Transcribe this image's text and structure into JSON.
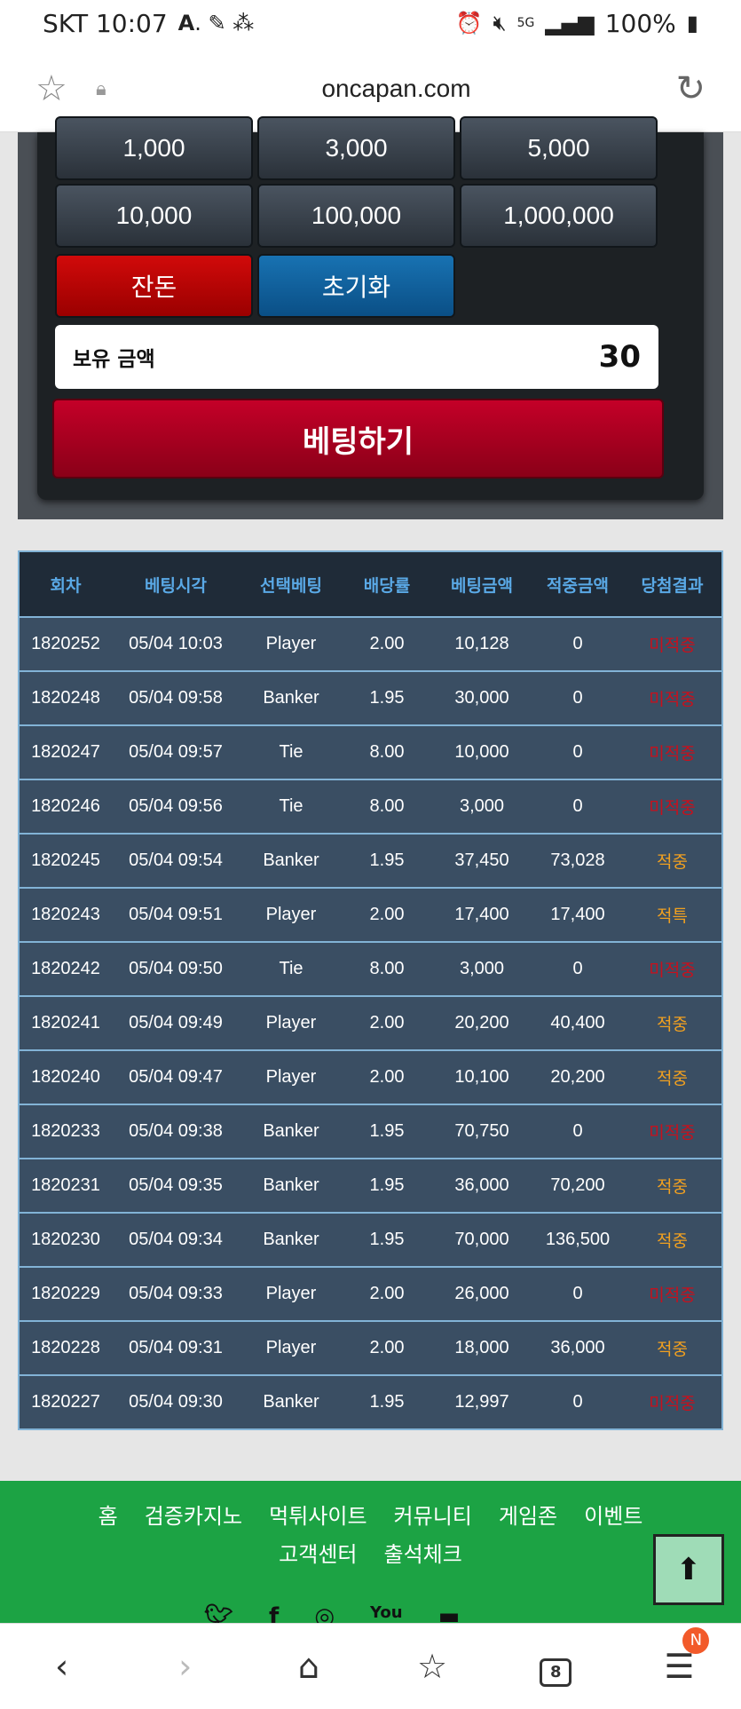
{
  "status_bar": {
    "carrier_time": "SKT 10:07",
    "battery": "100%",
    "network": "5G"
  },
  "browser": {
    "url": "oncapan.com",
    "tabs_count": "8",
    "notification_badge": "N"
  },
  "chips": [
    "1,000",
    "3,000",
    "5,000",
    "10,000",
    "100,000",
    "1,000,000"
  ],
  "actions": {
    "change_label": "잔돈",
    "reset_label": "초기화",
    "bet_label": "베팅하기"
  },
  "balance": {
    "label": "보유 금액",
    "value": "30"
  },
  "table": {
    "headers": [
      "회차",
      "베팅시각",
      "선택베팅",
      "배당률",
      "베팅금액",
      "적중금액",
      "당첨결과"
    ],
    "rows": [
      [
        "1820252",
        "05/04 10:03",
        "Player",
        "2.00",
        "10,128",
        "0",
        "미적중"
      ],
      [
        "1820248",
        "05/04 09:58",
        "Banker",
        "1.95",
        "30,000",
        "0",
        "미적중"
      ],
      [
        "1820247",
        "05/04 09:57",
        "Tie",
        "8.00",
        "10,000",
        "0",
        "미적중"
      ],
      [
        "1820246",
        "05/04 09:56",
        "Tie",
        "8.00",
        "3,000",
        "0",
        "미적중"
      ],
      [
        "1820245",
        "05/04 09:54",
        "Banker",
        "1.95",
        "37,450",
        "73,028",
        "적중"
      ],
      [
        "1820243",
        "05/04 09:51",
        "Player",
        "2.00",
        "17,400",
        "17,400",
        "적특"
      ],
      [
        "1820242",
        "05/04 09:50",
        "Tie",
        "8.00",
        "3,000",
        "0",
        "미적중"
      ],
      [
        "1820241",
        "05/04 09:49",
        "Player",
        "2.00",
        "20,200",
        "40,400",
        "적중"
      ],
      [
        "1820240",
        "05/04 09:47",
        "Player",
        "2.00",
        "10,100",
        "20,200",
        "적중"
      ],
      [
        "1820233",
        "05/04 09:38",
        "Banker",
        "1.95",
        "70,750",
        "0",
        "미적중"
      ],
      [
        "1820231",
        "05/04 09:35",
        "Banker",
        "1.95",
        "36,000",
        "70,200",
        "적중"
      ],
      [
        "1820230",
        "05/04 09:34",
        "Banker",
        "1.95",
        "70,000",
        "136,500",
        "적중"
      ],
      [
        "1820229",
        "05/04 09:33",
        "Player",
        "2.00",
        "26,000",
        "0",
        "미적중"
      ],
      [
        "1820228",
        "05/04 09:31",
        "Player",
        "2.00",
        "18,000",
        "36,000",
        "적중"
      ],
      [
        "1820227",
        "05/04 09:30",
        "Banker",
        "1.95",
        "12,997",
        "0",
        "미적중"
      ]
    ]
  },
  "footer": {
    "nav": [
      "홈",
      "검증카지노",
      "먹튀사이트",
      "커뮤니티",
      "게임존",
      "이벤트",
      "고객센터",
      "출석체크"
    ]
  },
  "colors": {
    "miss": "#c8101c",
    "hit": "#f0a020",
    "footer_bg": "#1ca344"
  }
}
